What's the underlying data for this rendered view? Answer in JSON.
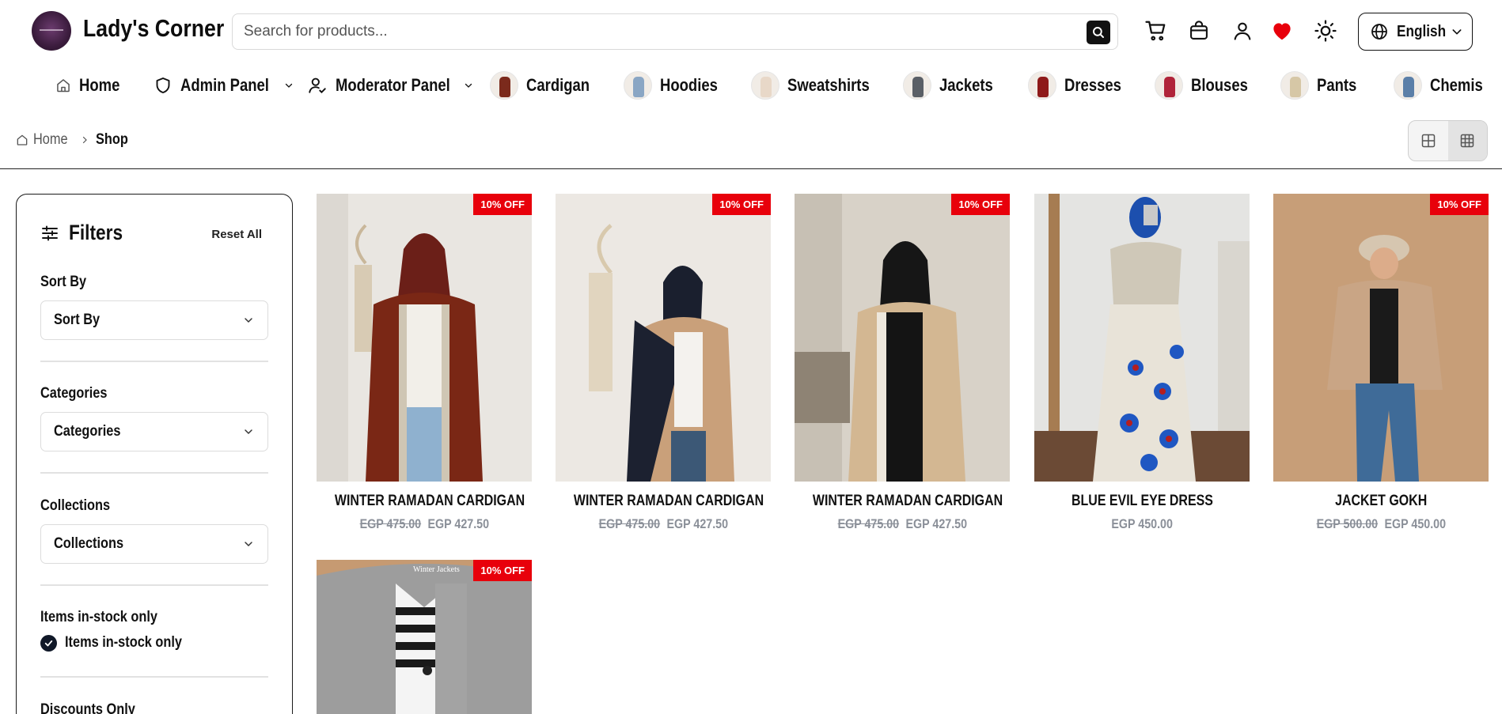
{
  "header": {
    "brand": "Lady's Corner",
    "search_placeholder": "Search for products...",
    "language": "English",
    "icons": [
      "search-icon",
      "cart-icon",
      "shopping-bag-icon",
      "user-icon",
      "heart-icon",
      "sun-icon",
      "globe-icon",
      "chevron-down-icon"
    ],
    "heart_color": "#e8000b"
  },
  "nav": {
    "items": [
      {
        "label": "Home",
        "icon": "home-icon"
      },
      {
        "label": "Admin Panel",
        "icon": "shield-icon",
        "dropdown": true
      },
      {
        "label": "Moderator Panel",
        "icon": "user-check-icon",
        "dropdown": true
      },
      {
        "label": "Cardigan",
        "thumb_color": "#7b2a1c"
      },
      {
        "label": "Hoodies",
        "thumb_color": "#8aa6c4"
      },
      {
        "label": "Sweatshirts",
        "thumb_color": "#e8d8c8"
      },
      {
        "label": "Jackets",
        "thumb_color": "#5a5f66"
      },
      {
        "label": "Dresses",
        "thumb_color": "#8e1a1a"
      },
      {
        "label": "Blouses",
        "thumb_color": "#b0243a"
      },
      {
        "label": "Pants",
        "thumb_color": "#d6c7a6"
      },
      {
        "label": "Chemis",
        "thumb_color": "#5b7fa8"
      }
    ]
  },
  "breadcrumb": {
    "home": "Home",
    "current": "Shop"
  },
  "filters": {
    "title": "Filters",
    "reset": "Reset All",
    "sort_label": "Sort By",
    "sort_value": "Sort By",
    "categories_label": "Categories",
    "categories_value": "Categories",
    "collections_label": "Collections",
    "collections_value": "Collections",
    "stock_label": "Items in-stock only",
    "stock_check": "Items in-stock only",
    "discounts_label": "Discounts Only"
  },
  "products": [
    {
      "name": "WINTER RAMADAN CARDIGAN",
      "old_price": "EGP 475.00",
      "price": "EGP 427.50",
      "badge": "10% OFF"
    },
    {
      "name": "WINTER RAMADAN CARDIGAN",
      "old_price": "EGP 475.00",
      "price": "EGP 427.50",
      "badge": "10% OFF"
    },
    {
      "name": "WINTER RAMADAN CARDIGAN",
      "old_price": "EGP 475.00",
      "price": "EGP 427.50",
      "badge": "10% OFF"
    },
    {
      "name": "BLUE EVIL EYE DRESS",
      "old_price": "",
      "price": "EGP 450.00",
      "badge": ""
    },
    {
      "name": "JACKET GOKH",
      "old_price": "EGP 500.00",
      "price": "EGP 450.00",
      "badge": "10% OFF"
    },
    {
      "name": "",
      "old_price": "",
      "price": "",
      "badge": "10% OFF",
      "image_caption": "Winter Jackets"
    }
  ]
}
